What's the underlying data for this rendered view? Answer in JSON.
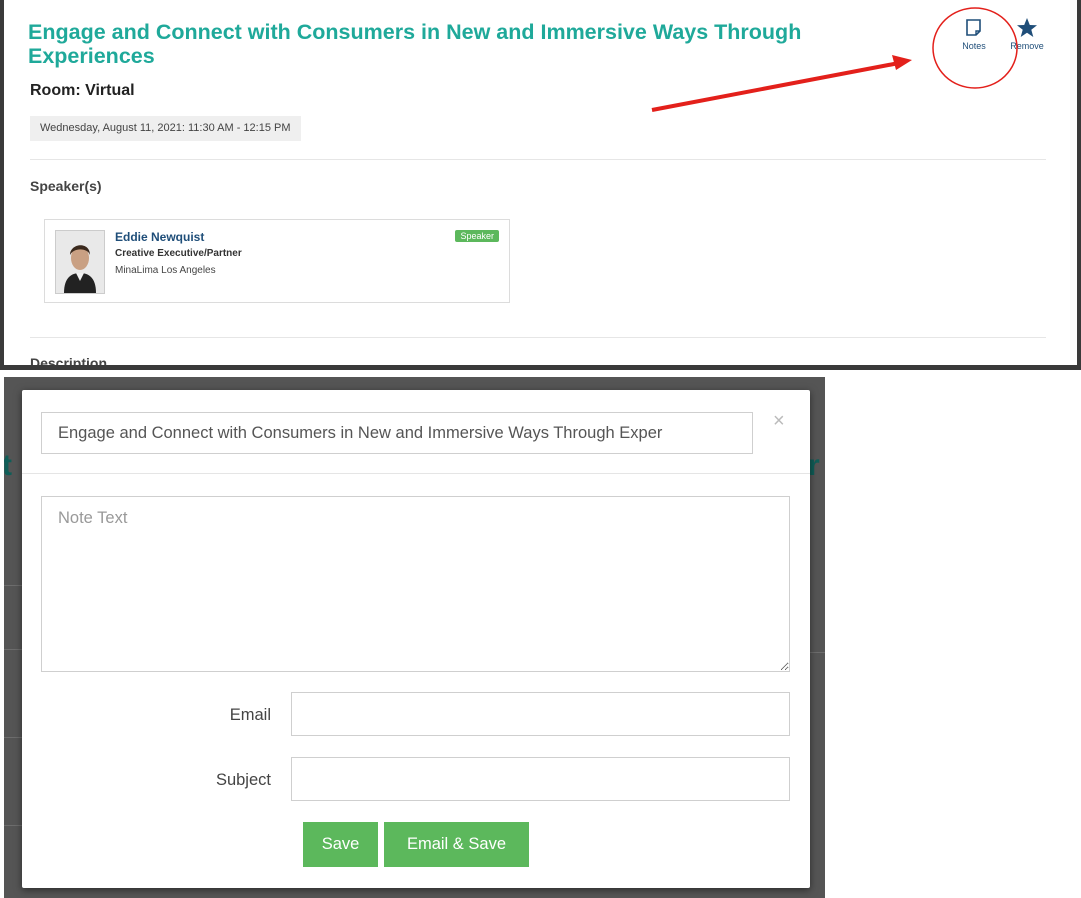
{
  "session": {
    "title": "Engage and Connect with Consumers in New and Immersive Ways Through Experiences",
    "room": "Room: Virtual",
    "datetime": "Wednesday, August 11, 2021: 11:30 AM - 12:15 PM",
    "actions": {
      "notes_label": "Notes",
      "notes_icon": "note-icon",
      "remove_label": "Remove",
      "remove_icon": "star-icon"
    },
    "speakers_heading": "Speaker(s)",
    "speaker": {
      "name": "Eddie Newquist",
      "role": "Creative Executive/Partner",
      "org": "MinaLima Los Angeles",
      "badge": "Speaker"
    },
    "description_heading": "Description"
  },
  "annotation": {
    "color": "#e3201b"
  },
  "notes_modal": {
    "title_value": "Engage and Connect with Consumers in New and Immersive Ways Through Exper",
    "close_label": "×",
    "note_placeholder": "Note Text",
    "email_label": "Email",
    "email_value": "",
    "subject_label": "Subject",
    "subject_value": "",
    "save_label": "Save",
    "email_save_label": "Email & Save"
  },
  "colors": {
    "title": "#1fa99a",
    "link": "#1f4e79",
    "button": "#5cb85c"
  }
}
